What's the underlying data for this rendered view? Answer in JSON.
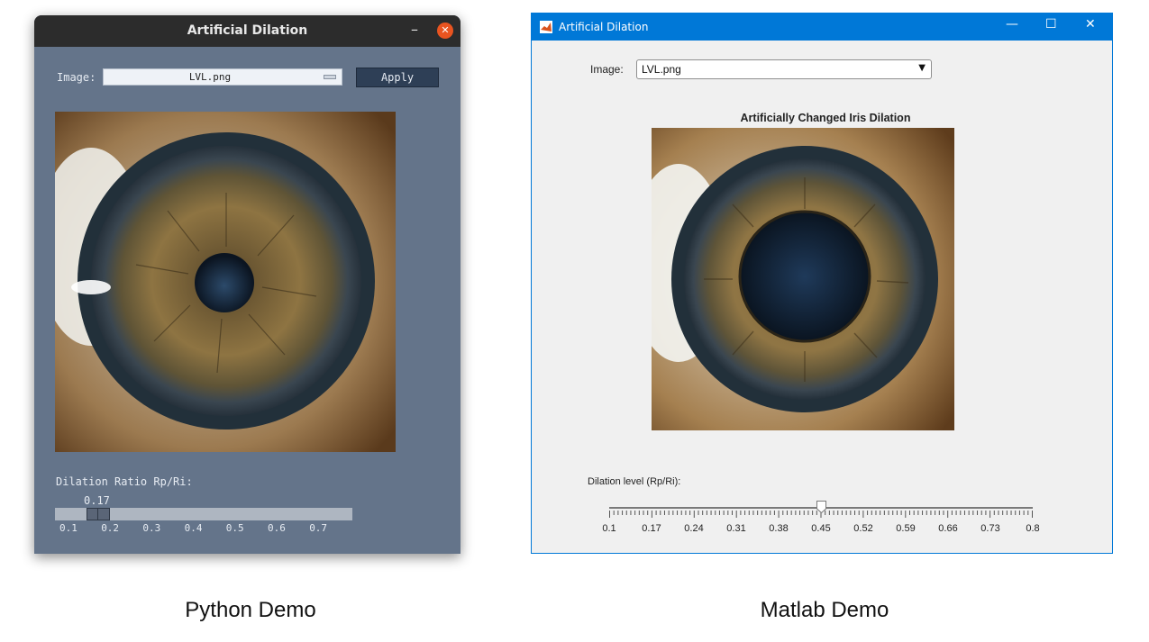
{
  "python_window": {
    "title": "Artificial Dilation",
    "image_label": "Image:",
    "image_select_value": "LVL.png",
    "apply_label": "Apply",
    "dilation_label": "Dilation Ratio Rp/Ri:",
    "slider_value": "0.17",
    "slider_level": 0.17,
    "slider_ticks": [
      "0.1",
      "0.2",
      "0.3",
      "0.4",
      "0.5",
      "0.6",
      "0.7"
    ],
    "minimize_glyph": "–",
    "close_glyph": "✕"
  },
  "matlab_window": {
    "title": "Artificial Dilation",
    "image_label": "Image:",
    "image_select_value": "LVL.png",
    "axes_title": "Artificially Changed Iris Dilation",
    "dilation_label": "Dilation level (Rp/Ri):",
    "slider_level": 0.45,
    "slider_ticks": [
      "0.1",
      "0.17",
      "0.24",
      "0.31",
      "0.38",
      "0.45",
      "0.52",
      "0.59",
      "0.66",
      "0.73",
      "0.8"
    ],
    "minimize_glyph": "—",
    "maximize_glyph": "☐",
    "close_glyph": "✕"
  },
  "captions": {
    "python": "Python Demo",
    "matlab": "Matlab Demo"
  },
  "colors": {
    "python_bg": "#64748a",
    "python_titlebar": "#2c2c2c",
    "python_close": "#e95420",
    "matlab_titlebar": "#0078d7",
    "matlab_bg": "#f0f0f0"
  },
  "icons": [
    "matlab-logo-icon",
    "minimize-icon",
    "maximize-icon",
    "close-icon",
    "dropdown-arrow-icon"
  ]
}
